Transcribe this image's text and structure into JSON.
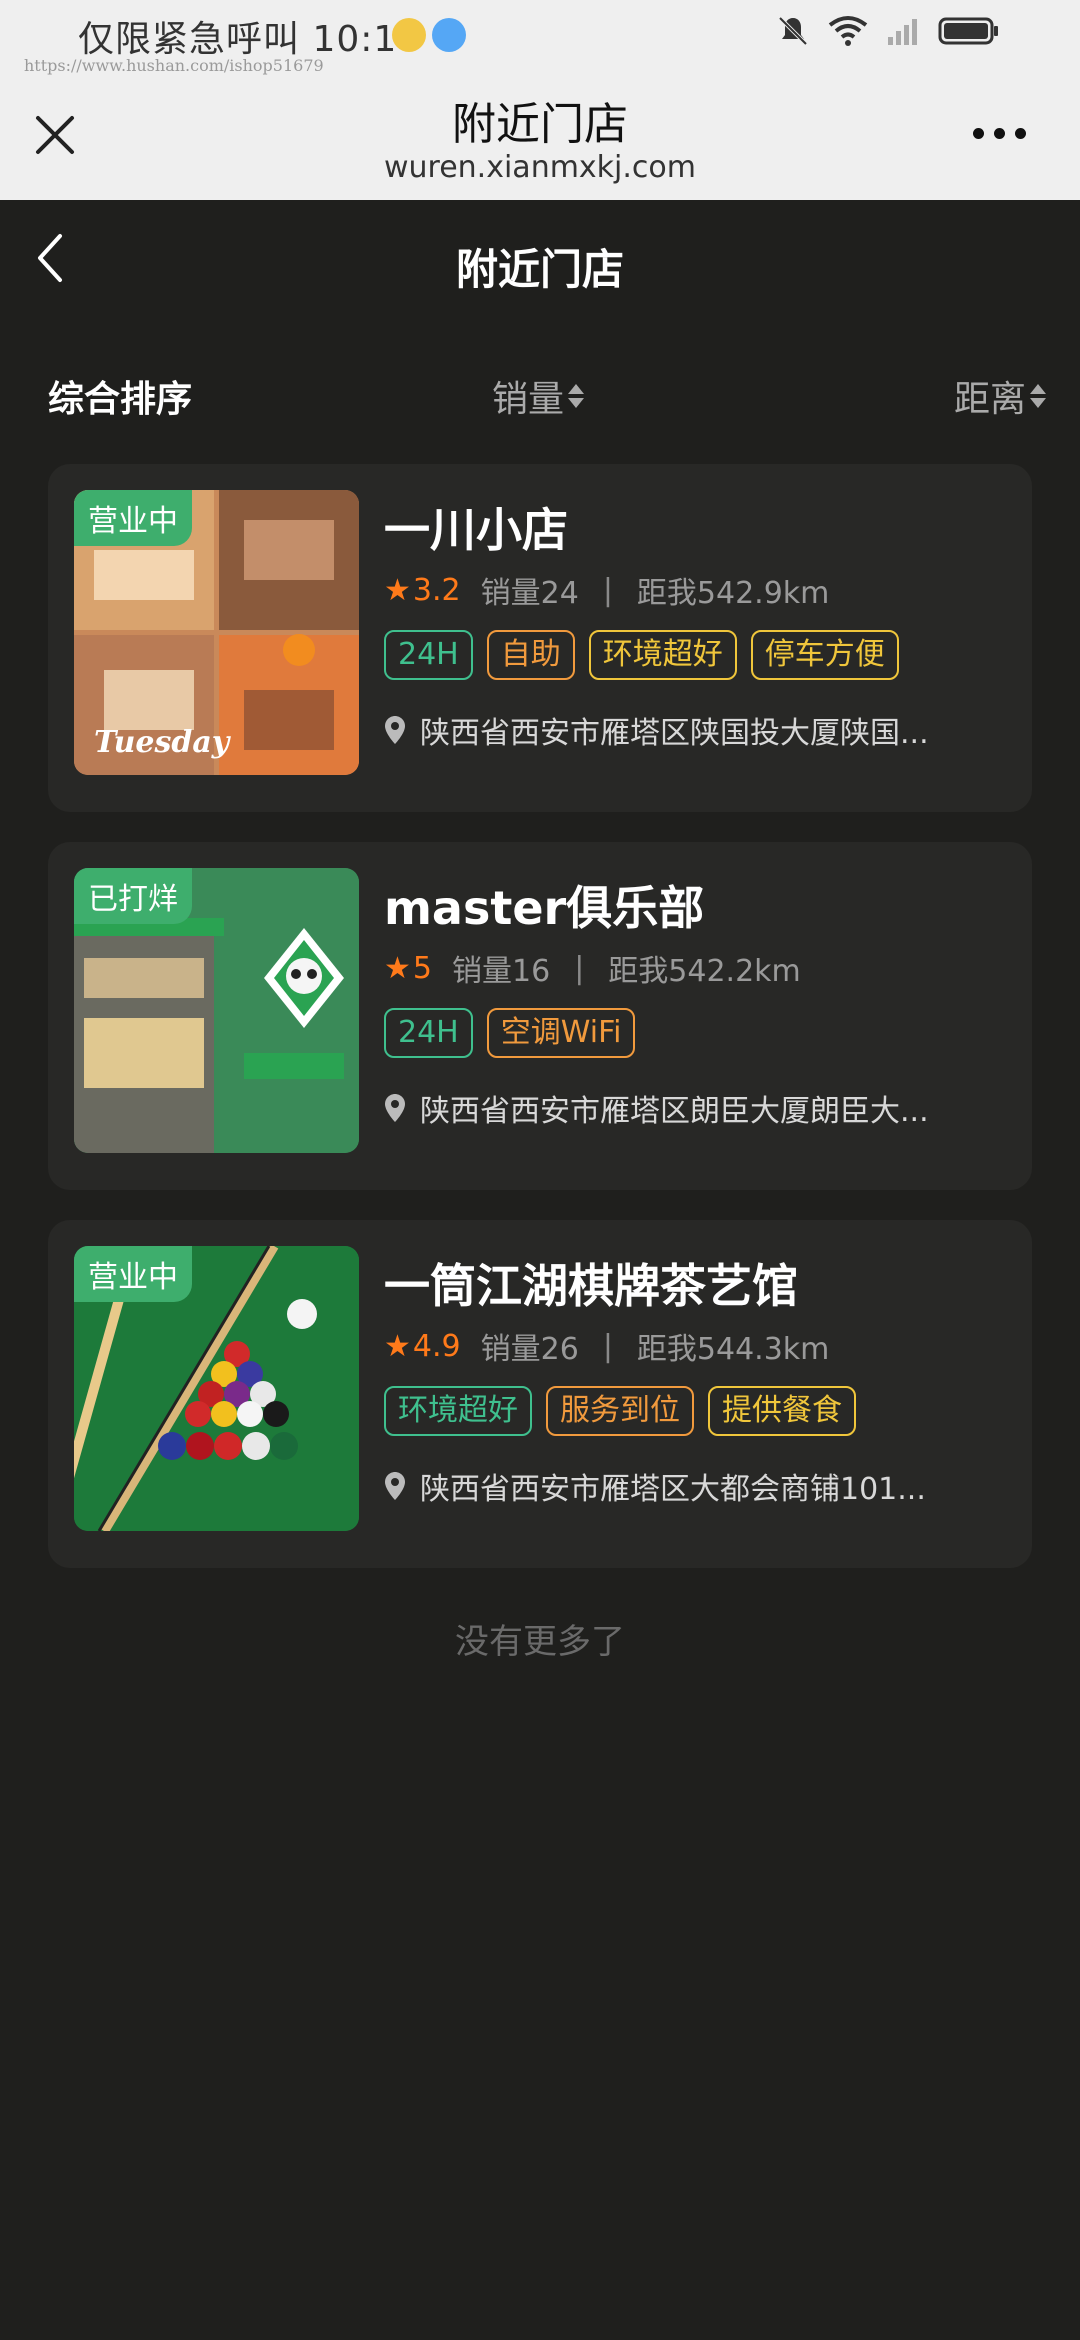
{
  "status_bar": {
    "carrier_time": "仅限紧急呼叫 10:17",
    "watermark": "https://www.hushan.com/ishop51679"
  },
  "browser": {
    "title": "附近门店",
    "url": "wuren.xianmxkj.com"
  },
  "page": {
    "title": "附近门店"
  },
  "sort": {
    "comprehensive": "综合排序",
    "sales": "销量",
    "distance": "距离"
  },
  "stores": [
    {
      "badge": "营业中",
      "name": "一川小店",
      "rating": "3.2",
      "sales": "销量24",
      "distance": "距我542.9km",
      "tags": [
        {
          "text": "24H",
          "color": "green"
        },
        {
          "text": "自助",
          "color": "orange"
        },
        {
          "text": "环境超好",
          "color": "yellow"
        },
        {
          "text": "停车方便",
          "color": "yellow"
        }
      ],
      "address": "陕西省西安市雁塔区陕国投大厦陕国..."
    },
    {
      "badge": "已打烊",
      "name": "master俱乐部",
      "rating": "5",
      "sales": "销量16",
      "distance": "距我542.2km",
      "tags": [
        {
          "text": "24H",
          "color": "green"
        },
        {
          "text": "空调WiFi",
          "color": "orange"
        }
      ],
      "address": "陕西省西安市雁塔区朗臣大厦朗臣大..."
    },
    {
      "badge": "营业中",
      "name": "一筒江湖棋牌茶艺馆",
      "rating": "4.9",
      "sales": "销量26",
      "distance": "距我544.3km",
      "tags": [
        {
          "text": "环境超好",
          "color": "green"
        },
        {
          "text": "服务到位",
          "color": "orange"
        },
        {
          "text": "提供餐食",
          "color": "yellow"
        }
      ],
      "address": "陕西省西安市雁塔区大都会商铺101..."
    }
  ],
  "footer": {
    "no_more": "没有更多了"
  }
}
